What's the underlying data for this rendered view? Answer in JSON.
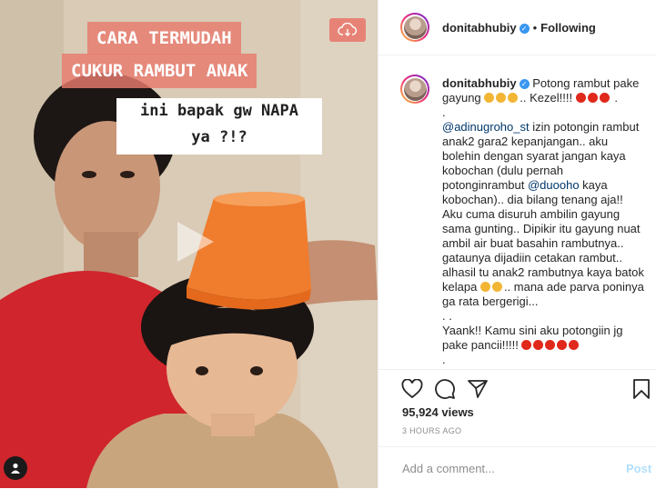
{
  "video": {
    "caption_line1": "CARA TERMUDAH",
    "caption_line2": "CUKUR RAMBUT ANAK",
    "caption_line3": "ini bapak gw NAPA",
    "caption_line4": "ya ?!?",
    "icons": [
      "cloud-download-icon",
      "play-icon",
      "mute-icon"
    ],
    "accent_color": "#e87a6e"
  },
  "header": {
    "username": "donitabhubiy",
    "separator": "•",
    "follow_status": "Following"
  },
  "caption": {
    "username": "donitabhubiy",
    "p1_a": "Potong rambut pake gayung",
    "p1_b": ".. Kezel!!!!",
    "p1_c": ".",
    "p2": ".",
    "mention1": "@adinugroho_st",
    "p3_a": "izin potongin rambut anak2 gara2 kepanjangan.. aku bolehin dengan syarat jangan kaya kobochan (dulu pernah potonginrambut",
    "mention2": "@duooho",
    "p3_b": "kaya kobochan).. dia bilang tenang aja!! Aku cuma disuruh ambilin gayung sama gunting.. Dipikir itu gayung nuat ambil air buat basahin rambutnya.. gataunya dijadiin cetakan rambut.. alhasil tu anak2 rambutnya kaya batok kelapa",
    "p3_c": ".. mana ade parva poninya ga rata bergerigi...",
    "p4": ". .",
    "p5": "Yaank!! Kamu sini aku potongiin jg pake pancii!!!!!",
    "p6": "."
  },
  "actions": {
    "icons": [
      "heart-icon",
      "comment-icon",
      "share-icon",
      "bookmark-icon"
    ]
  },
  "stats": {
    "views": "95,924 views",
    "time": "3 HOURS AGO"
  },
  "comment_box": {
    "placeholder": "Add a comment...",
    "post_label": "Post"
  }
}
